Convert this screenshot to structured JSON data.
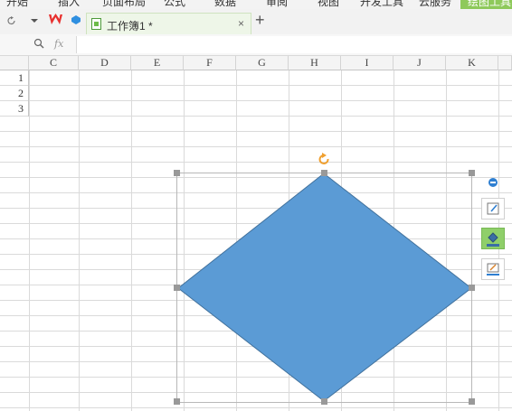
{
  "menu": {
    "items": [
      "开始",
      "插入",
      "页面布局",
      "公式",
      "数据",
      "审阅",
      "视图",
      "开发工具",
      "云服务",
      "绘图工具"
    ],
    "active_item": "绘图工具"
  },
  "tabbar": {
    "doc_title": "工作簿1 *",
    "close_symbol": "×",
    "new_tab_symbol": "+"
  },
  "formula_bar": {
    "fx_label": "fx",
    "cell_value": ""
  },
  "sheet": {
    "columns": [
      "C",
      "D",
      "E",
      "F",
      "G",
      "H",
      "I",
      "J",
      "K"
    ],
    "rows": [
      "1",
      "2",
      "3"
    ]
  },
  "shape": {
    "type": "diamond",
    "fill_color": "#5b9bd5",
    "outline_color": "#41719c",
    "rotate_handle_color": "#f0a030"
  },
  "floating_toolbar": {
    "buttons": [
      "shape-style-icon",
      "fill-color-icon",
      "outline-color-icon"
    ],
    "active_button": "fill-color-icon"
  }
}
